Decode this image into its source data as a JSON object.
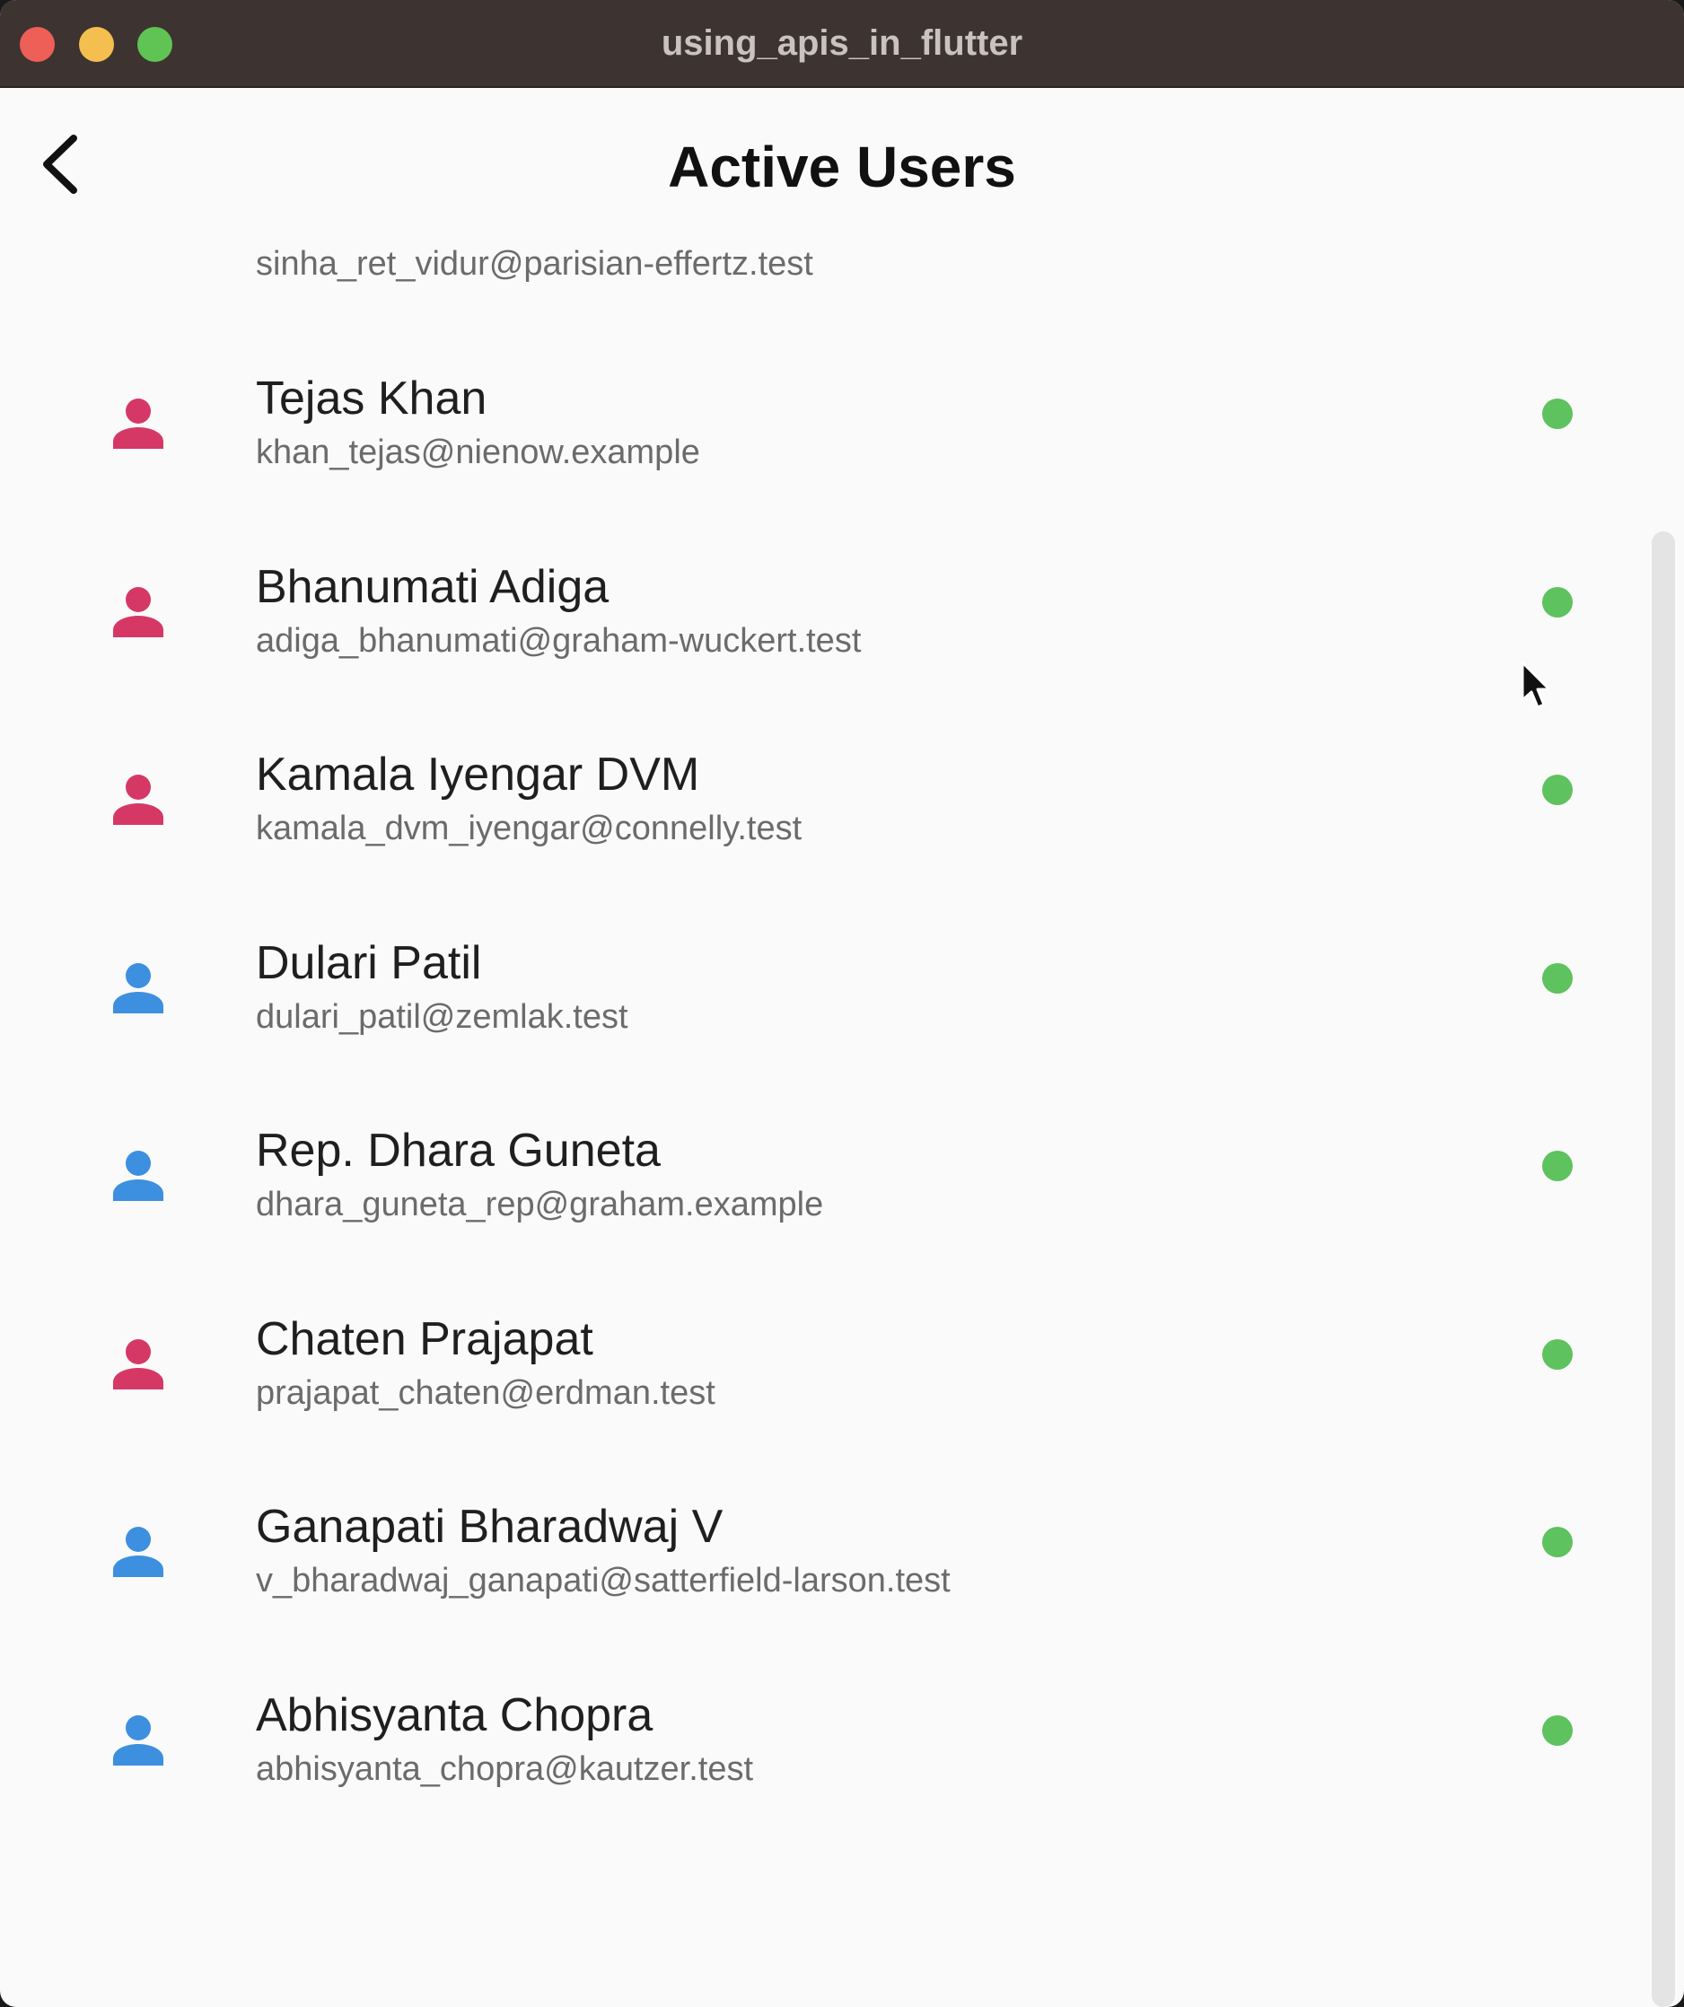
{
  "window": {
    "title": "using_apis_in_flutter"
  },
  "appbar": {
    "title": "Active Users",
    "back_icon": "chevron-left-icon"
  },
  "list": {
    "partial_email": "sinha_ret_vidur@parisian-effertz.test",
    "users": [
      {
        "name": "Tejas Khan",
        "email": "khan_tejas@nienow.example",
        "gender": "female",
        "status": "active"
      },
      {
        "name": "Bhanumati Adiga",
        "email": "adiga_bhanumati@graham-wuckert.test",
        "gender": "female",
        "status": "active"
      },
      {
        "name": "Kamala Iyengar DVM",
        "email": "kamala_dvm_iyengar@connelly.test",
        "gender": "female",
        "status": "active"
      },
      {
        "name": "Dulari Patil",
        "email": "dulari_patil@zemlak.test",
        "gender": "male",
        "status": "active"
      },
      {
        "name": "Rep. Dhara Guneta",
        "email": "dhara_guneta_rep@graham.example",
        "gender": "male",
        "status": "active"
      },
      {
        "name": "Chaten Prajapat",
        "email": "prajapat_chaten@erdman.test",
        "gender": "female",
        "status": "active"
      },
      {
        "name": "Ganapati Bharadwaj V",
        "email": "v_bharadwaj_ganapati@satterfield-larson.test",
        "gender": "male",
        "status": "active"
      },
      {
        "name": "Abhisyanta Chopra",
        "email": "abhisyanta_chopra@kautzer.test",
        "gender": "male",
        "status": "active"
      }
    ]
  },
  "colors": {
    "female_avatar": "#d63866",
    "male_avatar": "#3d8fe0",
    "active_dot": "#5ec25e"
  }
}
